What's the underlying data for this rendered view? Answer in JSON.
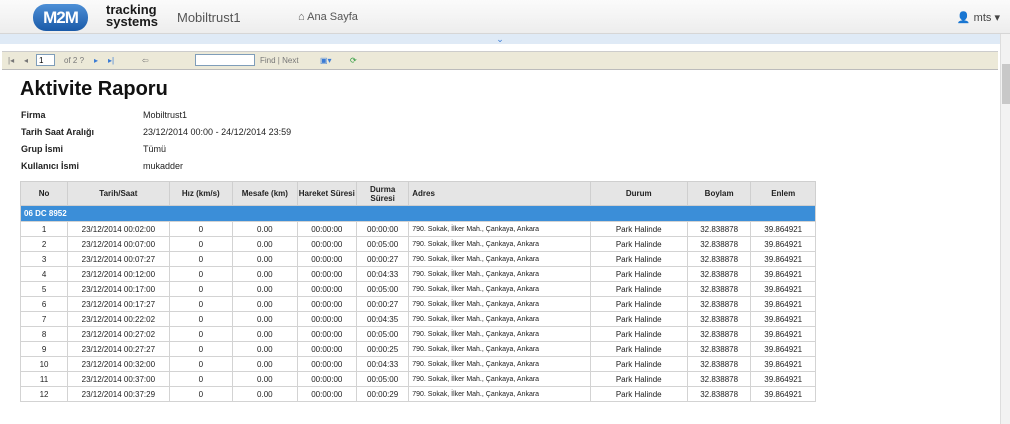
{
  "header": {
    "logo_text": "M2M",
    "brand_line1": "tracking",
    "brand_line2": "systems",
    "app_name": "Mobiltrust1",
    "home_label": "Ana Sayfa",
    "user_label": "mts"
  },
  "toolbar": {
    "page_value": "1",
    "page_of": "of 2 ?",
    "find_label": "Find | Next"
  },
  "report": {
    "title": "Aktivite Raporu",
    "fields": [
      {
        "label": "Firma",
        "value": "Mobiltrust1"
      },
      {
        "label": "Tarih Saat Aralığı",
        "value": "23/12/2014 00:00 - 24/12/2014 23:59"
      },
      {
        "label": "Grup İsmi",
        "value": "Tümü"
      },
      {
        "label": "Kullanıcı İsmi",
        "value": "mukadder"
      }
    ],
    "columns": [
      "No",
      "Tarih/Saat",
      "Hız (km/s)",
      "Mesafe (km)",
      "Hareket Süresi",
      "Durma Süresi",
      "Adres",
      "Durum",
      "Boylam",
      "Enlem"
    ],
    "group_label": "06 DC 8952",
    "rows": [
      [
        "1",
        "23/12/2014 00:02:00",
        "0",
        "0.00",
        "00:00:00",
        "00:00:00",
        "790. Sokak, İlker Mah., Çankaya, Ankara",
        "Park Halinde",
        "32.838878",
        "39.864921"
      ],
      [
        "2",
        "23/12/2014 00:07:00",
        "0",
        "0.00",
        "00:00:00",
        "00:05:00",
        "790. Sokak, İlker Mah., Çankaya, Ankara",
        "Park Halinde",
        "32.838878",
        "39.864921"
      ],
      [
        "3",
        "23/12/2014 00:07:27",
        "0",
        "0.00",
        "00:00:00",
        "00:00:27",
        "790. Sokak, İlker Mah., Çankaya, Ankara",
        "Park Halinde",
        "32.838878",
        "39.864921"
      ],
      [
        "4",
        "23/12/2014 00:12:00",
        "0",
        "0.00",
        "00:00:00",
        "00:04:33",
        "790. Sokak, İlker Mah., Çankaya, Ankara",
        "Park Halinde",
        "32.838878",
        "39.864921"
      ],
      [
        "5",
        "23/12/2014 00:17:00",
        "0",
        "0.00",
        "00:00:00",
        "00:05:00",
        "790. Sokak, İlker Mah., Çankaya, Ankara",
        "Park Halinde",
        "32.838878",
        "39.864921"
      ],
      [
        "6",
        "23/12/2014 00:17:27",
        "0",
        "0.00",
        "00:00:00",
        "00:00:27",
        "790. Sokak, İlker Mah., Çankaya, Ankara",
        "Park Halinde",
        "32.838878",
        "39.864921"
      ],
      [
        "7",
        "23/12/2014 00:22:02",
        "0",
        "0.00",
        "00:00:00",
        "00:04:35",
        "790. Sokak, İlker Mah., Çankaya, Ankara",
        "Park Halinde",
        "32.838878",
        "39.864921"
      ],
      [
        "8",
        "23/12/2014 00:27:02",
        "0",
        "0.00",
        "00:00:00",
        "00:05:00",
        "790. Sokak, İlker Mah., Çankaya, Ankara",
        "Park Halinde",
        "32.838878",
        "39.864921"
      ],
      [
        "9",
        "23/12/2014 00:27:27",
        "0",
        "0.00",
        "00:00:00",
        "00:00:25",
        "790. Sokak, İlker Mah., Çankaya, Ankara",
        "Park Halinde",
        "32.838878",
        "39.864921"
      ],
      [
        "10",
        "23/12/2014 00:32:00",
        "0",
        "0.00",
        "00:00:00",
        "00:04:33",
        "790. Sokak, İlker Mah., Çankaya, Ankara",
        "Park Halinde",
        "32.838878",
        "39.864921"
      ],
      [
        "11",
        "23/12/2014 00:37:00",
        "0",
        "0.00",
        "00:00:00",
        "00:05:00",
        "790. Sokak, İlker Mah., Çankaya, Ankara",
        "Park Halinde",
        "32.838878",
        "39.864921"
      ],
      [
        "12",
        "23/12/2014 00:37:29",
        "0",
        "0.00",
        "00:00:00",
        "00:00:29",
        "790. Sokak, İlker Mah., Çankaya, Ankara",
        "Park Halinde",
        "32.838878",
        "39.864921"
      ]
    ]
  },
  "colors": {
    "group_row": "#3b8ed8",
    "accent": "#3a7bd5"
  }
}
